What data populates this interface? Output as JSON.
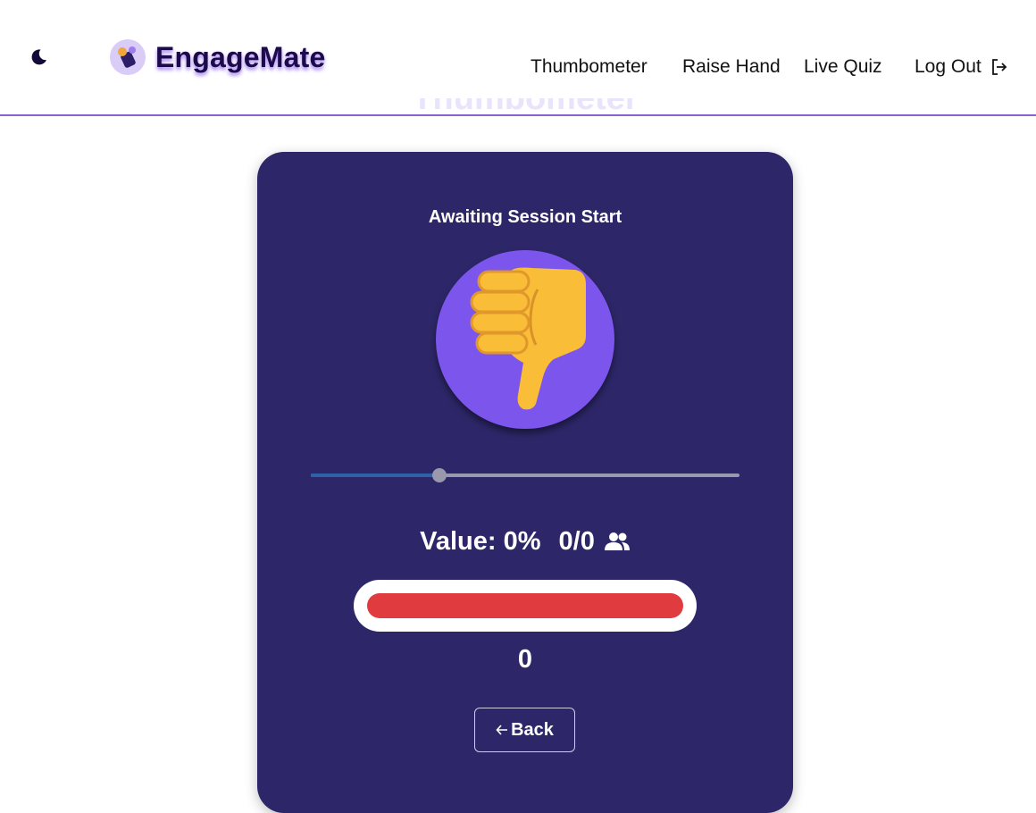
{
  "header": {
    "theme_toggle_icon": "moon-icon",
    "brand_name": "EngageMate",
    "brand_logo_icon": "engagemate-logo-icon",
    "nav": [
      {
        "label": "Thumbometer"
      },
      {
        "label": "Raise Hand"
      },
      {
        "label": "Live Quiz"
      }
    ],
    "logout_label": "Log Out",
    "logout_icon": "logout-icon"
  },
  "page": {
    "heading": "Thumbometer"
  },
  "card": {
    "status": "Awaiting Session Start",
    "thumb_icon": "thumbs-down-icon",
    "slider_value": 0.3,
    "value_label": "Value: 0%",
    "participants": "0/0",
    "participants_icon": "people-icon",
    "meter_fill": 1.0,
    "meter_number": "0",
    "back_label": "Back",
    "back_icon": "arrow-left-icon"
  },
  "colors": {
    "accent": "#8a63d2",
    "card_bg": "#2d2769",
    "circle_bg": "#7b55ec",
    "meter_red": "#e03c3f",
    "slider_fill": "#2d62a8",
    "brand_text": "#1c0a4a"
  }
}
